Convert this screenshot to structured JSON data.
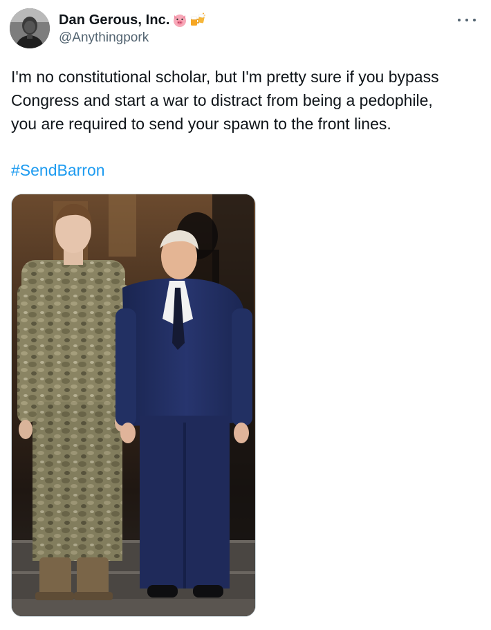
{
  "tweet": {
    "author": {
      "display_name": "Dan Gerous, Inc.",
      "emojis": [
        "pig-face-emoji",
        "beer-mugs-emoji"
      ],
      "handle": "@Anythingpork"
    },
    "more_menu": "more-options",
    "text_lines": [
      "I'm no constitutional scholar, but I'm pretty sure if you bypass",
      "Congress and start a war to distract from being a pedophile,",
      "you are required to send your spawn to the front lines."
    ],
    "hashtag": "#SendBarron",
    "colors": {
      "text": "#0f1419",
      "secondary": "#536471",
      "link": "#1d9bf0",
      "border": "#cfd9de"
    }
  }
}
